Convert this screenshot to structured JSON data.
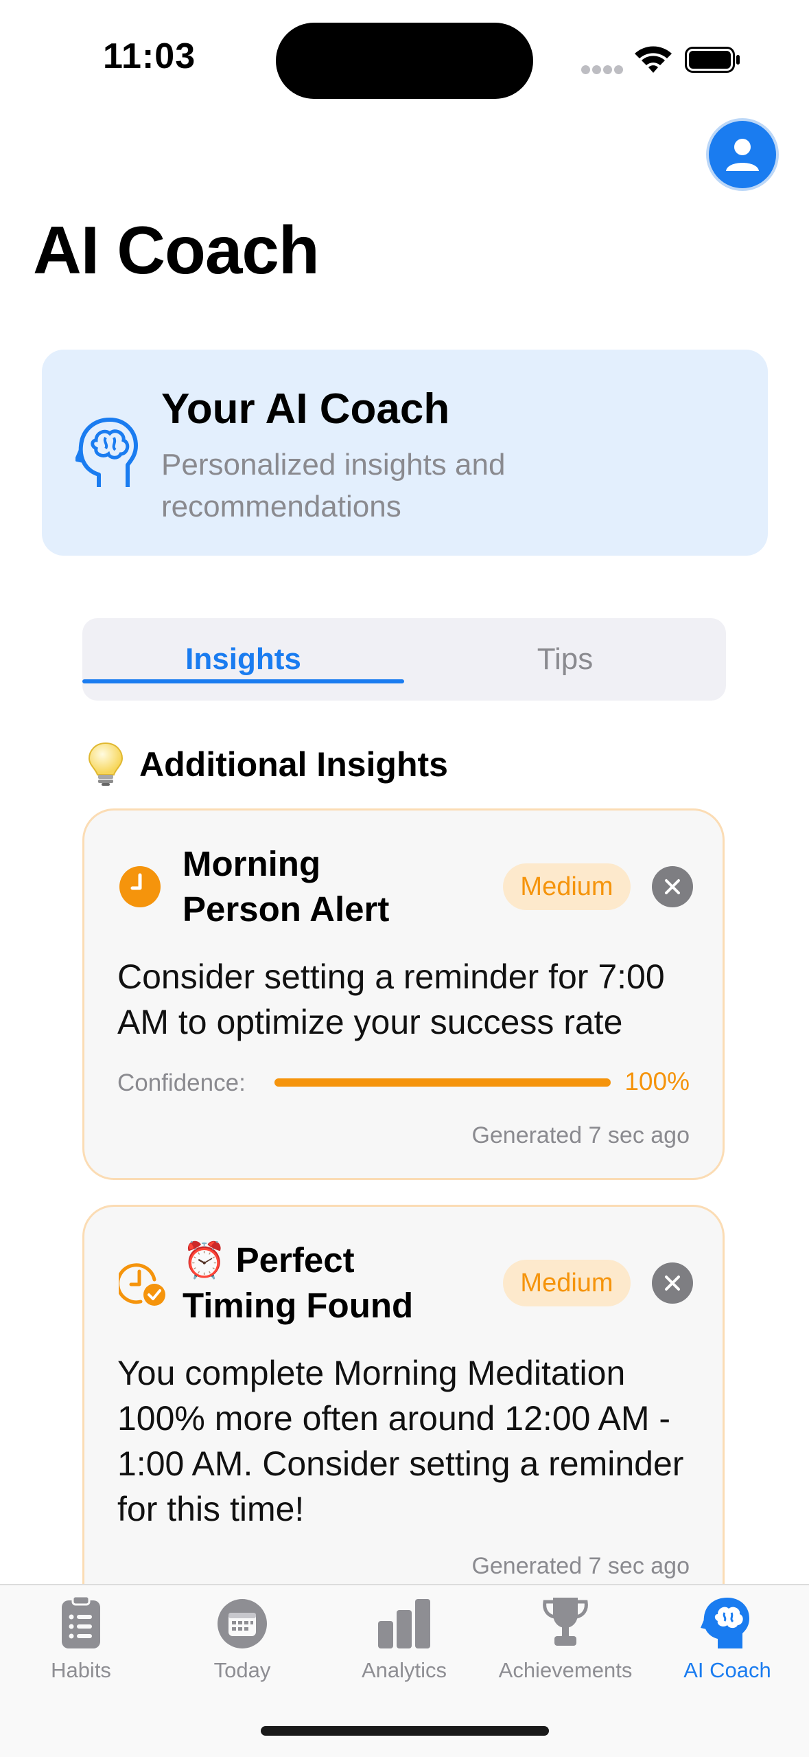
{
  "status_bar": {
    "time": "11:03"
  },
  "header": {
    "title": "AI Coach",
    "profile_icon": "person-circle-icon"
  },
  "coach_card": {
    "title": "Your AI Coach",
    "subtitle": "Personalized insights and recommendations",
    "icon": "brain-head-icon"
  },
  "tabs": [
    {
      "label": "Insights",
      "selected": true
    },
    {
      "label": "Tips",
      "selected": false
    }
  ],
  "section": {
    "emoji": "lightbulb-icon",
    "title": "Additional Insights"
  },
  "insights": [
    {
      "icon": "clock-icon",
      "title": "Morning Person Alert",
      "priority": "Medium",
      "body": "Consider setting a reminder for 7:00 AM to optimize your success rate",
      "confidence_label": "Confidence:",
      "confidence_value": 1.0,
      "confidence_text": "100%",
      "generated": "Generated 7 sec ago"
    },
    {
      "icon": "clock-checkmark-icon",
      "title": "⏰ Perfect Timing Found",
      "priority": "Medium",
      "body": "You complete Morning Meditation 100% more often around 12:00 AM - 1:00 AM. Consider setting a reminder for this time!",
      "generated": "Generated 7 sec ago"
    }
  ],
  "tab_bar": [
    {
      "label": "Habits",
      "icon": "clipboard-icon",
      "active": false
    },
    {
      "label": "Today",
      "icon": "calendar-icon",
      "active": false
    },
    {
      "label": "Analytics",
      "icon": "bar-chart-icon",
      "active": false
    },
    {
      "label": "Achievements",
      "icon": "trophy-icon",
      "active": false
    },
    {
      "label": "AI Coach",
      "icon": "brain-head-icon",
      "active": true
    }
  ],
  "colors": {
    "accent": "#1a7cf0",
    "warning": "#f5940c",
    "secondary_text": "#8a8a8f"
  }
}
